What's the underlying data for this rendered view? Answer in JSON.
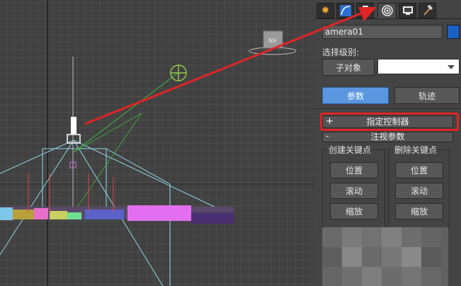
{
  "viewport": {
    "camera_name_tag": "",
    "navcube_label": "NV"
  },
  "panel": {
    "tabs": [
      {
        "name": "create-tab",
        "icon": "sun-star-icon"
      },
      {
        "name": "modify-tab",
        "icon": "modifier-curve-icon"
      },
      {
        "name": "hierarchy-tab",
        "icon": "hierarchy-icon"
      },
      {
        "name": "motion-tab",
        "icon": "motion-circle-icon"
      },
      {
        "name": "display-tab",
        "icon": "monitor-icon"
      },
      {
        "name": "utilities-tab",
        "icon": "hammer-icon"
      }
    ],
    "object_name": "amera01",
    "swatch_color": "#1b5fc4",
    "selection_level_label": "选择级别:",
    "subobject_button": "子对象",
    "params_button": "参数",
    "track_button": "轨迹",
    "assign_controller_rollout": "指定控制器",
    "assign_controller_toggle": "+",
    "look_at_rollout": "注视参数",
    "look_at_toggle": "-",
    "create_key_group": {
      "title": "创建关键点",
      "buttons": [
        "位置",
        "滚动",
        "缩放"
      ]
    },
    "delete_key_group": {
      "title": "删除关键点",
      "buttons": [
        "位置",
        "滚动",
        "缩放"
      ]
    }
  },
  "colors": {
    "accent_blue": "#5a97e0",
    "highlight_red": "#e02424"
  }
}
